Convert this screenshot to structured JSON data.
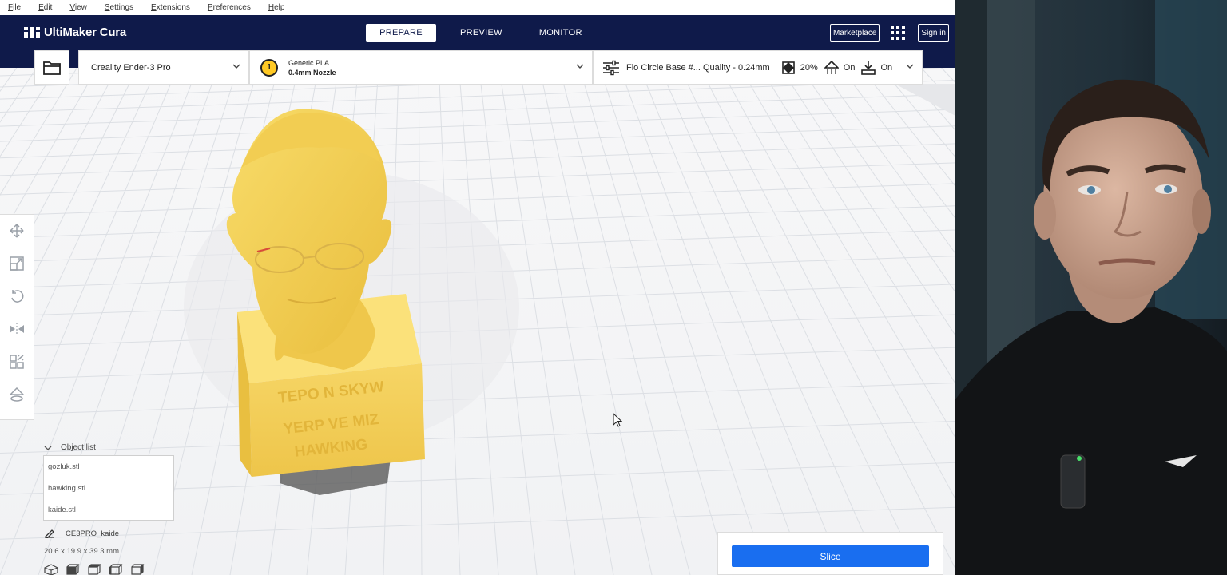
{
  "menu": [
    "File",
    "Edit",
    "View",
    "Settings",
    "Extensions",
    "Preferences",
    "Help"
  ],
  "app": {
    "title": "UltiMaker Cura"
  },
  "stages": [
    {
      "label": "PREPARE",
      "active": true
    },
    {
      "label": "PREVIEW",
      "active": false
    },
    {
      "label": "MONITOR",
      "active": false
    }
  ],
  "header_right": {
    "marketplace": "Marketplace",
    "signin": "Sign in",
    "apps_icon": "apps-grid-icon"
  },
  "toolbar": {
    "open_icon": "folder-icon",
    "printer": "Creality Ender-3 Pro",
    "material": {
      "extruder_number": "1",
      "name": "Generic PLA",
      "nozzle": "0.4mm Nozzle"
    },
    "settings": {
      "profile": "Flo Circle Base #... Quality - 0.24mm",
      "infill": "20%",
      "support": "On",
      "adhesion": "On"
    }
  },
  "tools": [
    "move-icon",
    "scale-icon",
    "rotate-icon",
    "mirror-icon",
    "per-model-settings-icon",
    "support-blocker-icon"
  ],
  "model_text": {
    "line1": "TEPO N SKYW",
    "line2": "YERP VE MIZ",
    "line3": "HAWKING"
  },
  "object_list": {
    "title": "Object list",
    "items": [
      "gozluk.stl",
      "hawking.stl",
      "kaide.stl"
    ],
    "job_name": "CE3PRO_kaide",
    "dimensions": "20.6 x 19.9 x 39.3 mm"
  },
  "slice": {
    "label": "Slice"
  },
  "colors": {
    "header": "#0f1a4a",
    "slice": "#196ef0",
    "model": "#f5cf5a",
    "material_badge": "#ffc924"
  }
}
